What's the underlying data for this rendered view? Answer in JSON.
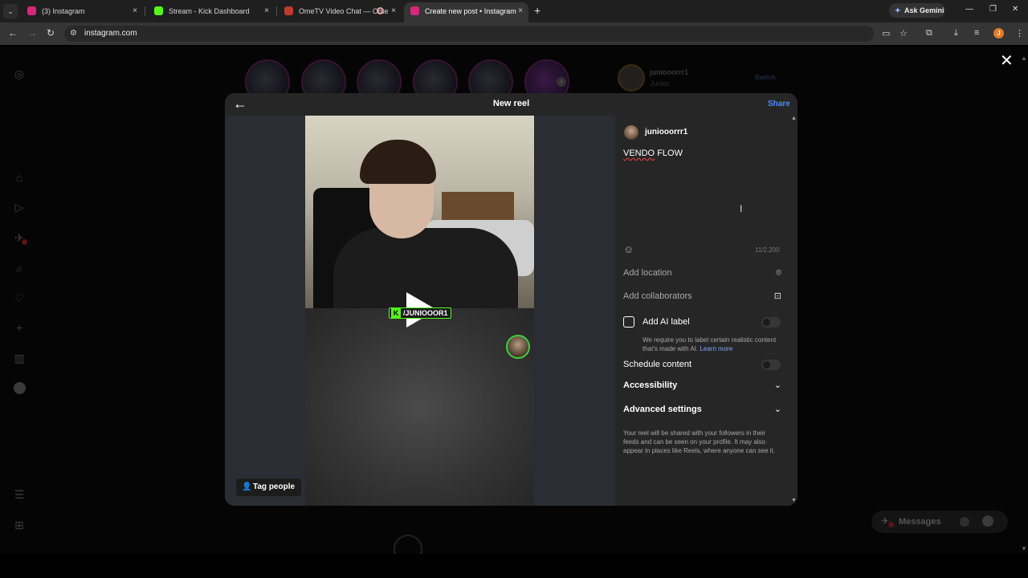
{
  "browser": {
    "tabs": [
      {
        "title": "(3) Instagram",
        "favicon_color": "#d6287a",
        "active": false
      },
      {
        "title": "Stream - Kick Dashboard",
        "favicon_color": "#53fc18",
        "active": false
      },
      {
        "title": "OmeTV Video Chat — Ome",
        "favicon_color": "#c0392b",
        "active": false
      },
      {
        "title": "Create new post • Instagram",
        "favicon_color": "#d6287a",
        "active": true
      }
    ],
    "tab_close_glyph": "×",
    "new_tab_glyph": "+",
    "ask_gemini_label": "Ask Gemini",
    "url": "instagram.com",
    "profile_initial": "J"
  },
  "page_bg": {
    "stories_count": 6,
    "me_username": "juniooorrr1",
    "me_display_name": "Junior",
    "switch_label": "Switch",
    "messages_label": "Messages",
    "notifications_badge": "3"
  },
  "modal": {
    "title": "New reel",
    "share_label": "Share",
    "tag_people_label": "Tag people",
    "video_overlay_tag": "/JUNIOOOR1",
    "kick_letter": "K"
  },
  "panel": {
    "username": "juniooorrr1",
    "caption_words": [
      "VENDO",
      "FLOW"
    ],
    "char_count": "11/2,200",
    "add_location": "Add location",
    "add_collaborators": "Add collaborators",
    "add_ai_label": "Add AI label",
    "ai_description": "We require you to label certain realistic content that's made with AI.",
    "ai_learn_more": "Learn more",
    "schedule_content": "Schedule content",
    "accessibility": "Accessibility",
    "advanced_settings": "Advanced settings",
    "footer_note": "Your reel will be shared with your followers in their feeds and can be seen on your profile. It may also appear in places like Reels, where anyone can see it."
  },
  "colors": {
    "accent_blue": "#4f8cff",
    "kick_green": "#53fc18",
    "modal_bg": "#262626"
  }
}
